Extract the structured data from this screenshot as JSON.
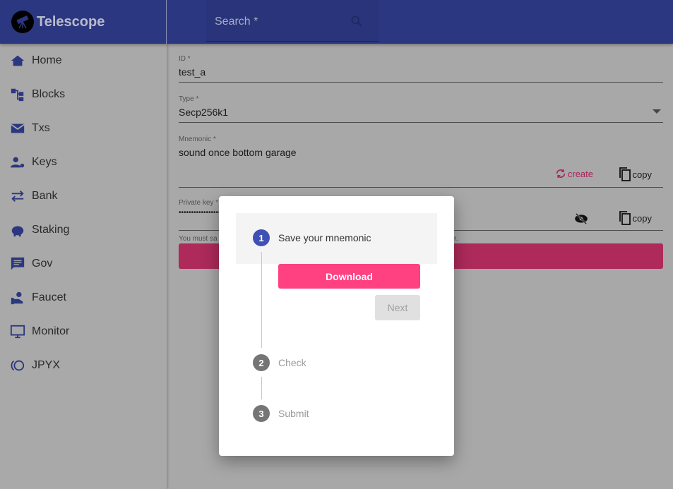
{
  "app": {
    "title": "Telescope"
  },
  "search": {
    "label": "Search *"
  },
  "sidebar": {
    "items": [
      {
        "label": "Home",
        "icon": "home-icon"
      },
      {
        "label": "Blocks",
        "icon": "blocks-icon"
      },
      {
        "label": "Txs",
        "icon": "mail-icon"
      },
      {
        "label": "Keys",
        "icon": "user-gear-icon"
      },
      {
        "label": "Bank",
        "icon": "swap-icon"
      },
      {
        "label": "Staking",
        "icon": "piggy-bank-icon"
      },
      {
        "label": "Gov",
        "icon": "chat-icon"
      },
      {
        "label": "Faucet",
        "icon": "faucet-icon"
      },
      {
        "label": "Monitor",
        "icon": "monitor-icon"
      },
      {
        "label": "JPYX",
        "icon": "jpyx-icon"
      }
    ]
  },
  "form": {
    "id_label": "ID *",
    "id_value": "test_a",
    "type_label": "Type *",
    "type_value": "Secp256k1",
    "mnemonic_label": "Mnemonic *",
    "mnemonic_value": "sound once bottom garage",
    "create_label": "create",
    "copy_label": "copy",
    "private_key_label": "Private key *",
    "private_key_value": "••••••••••••••••••",
    "warning": "You must sa",
    "warning_end": "r."
  },
  "dialog": {
    "steps": [
      {
        "number": "1",
        "label": "Save your mnemonic"
      },
      {
        "number": "2",
        "label": "Check"
      },
      {
        "number": "3",
        "label": "Submit"
      }
    ],
    "download_label": "Download",
    "next_label": "Next"
  },
  "colors": {
    "primary": "#3f51b5",
    "accent": "#ff4081"
  }
}
